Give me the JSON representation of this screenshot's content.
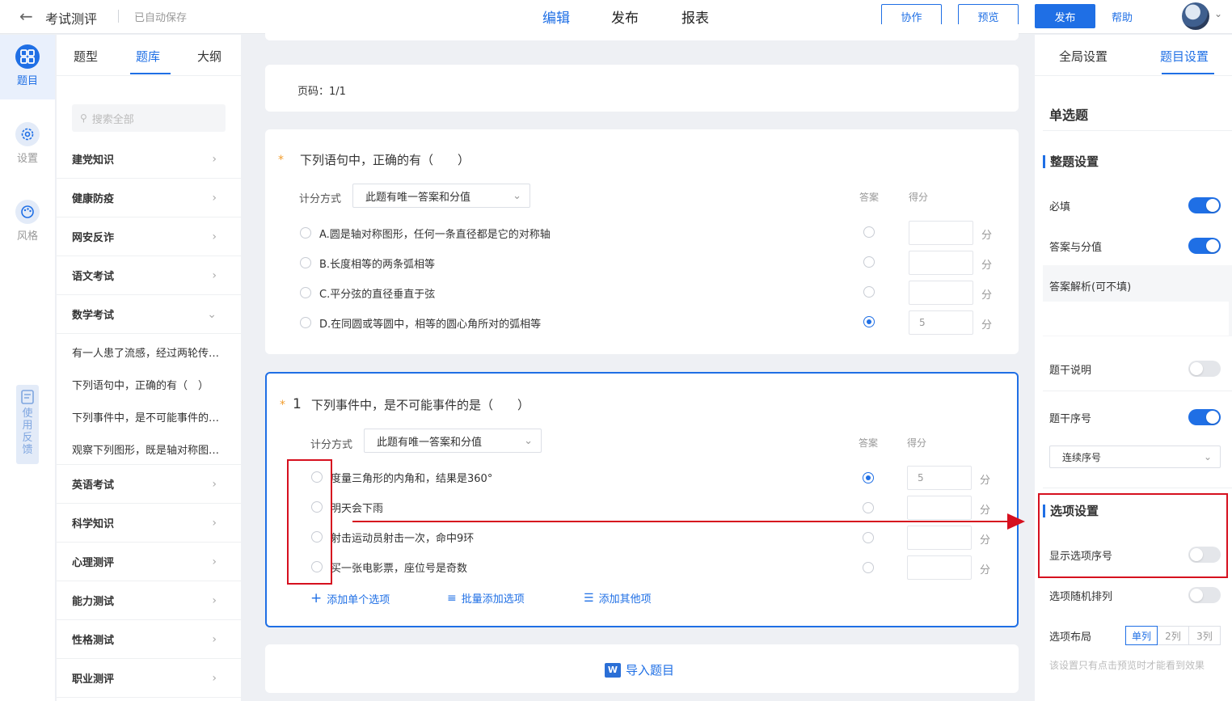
{
  "header": {
    "back_icon": "arrow-left-icon",
    "title": "考试测评",
    "autosave": "已自动保存",
    "tabs": [
      "编辑",
      "发布",
      "报表"
    ],
    "active_tab": "编辑",
    "buttons": {
      "collab": "协作",
      "preview": "预览",
      "publish": "发布",
      "help": "帮助"
    },
    "accent_color": "#1f6fe5"
  },
  "rail": {
    "items": [
      {
        "label": "题目",
        "icon": "grid-icon"
      },
      {
        "label": "设置",
        "icon": "gear-icon"
      },
      {
        "label": "风格",
        "icon": "palette-icon"
      }
    ],
    "feedback": "使用反馈"
  },
  "library": {
    "tabs": [
      "题型",
      "题库",
      "大纲"
    ],
    "active_tab": "题库",
    "search_placeholder": "搜索全部",
    "categories_top": [
      "建党知识",
      "健康防疫",
      "网安反诈",
      "语文考试",
      "数学考试"
    ],
    "expanded_questions": [
      "有一人患了流感，经过两轮传染后共有...",
      "下列语句中，正确的有（　）",
      "下列事件中，是不可能事件的是（　）",
      "观察下列图形，既是轴对称图形又是..."
    ],
    "categories_bottom": [
      "英语考试",
      "科学知识",
      "心理测评",
      "能力测试",
      "性格测试",
      "职业测评"
    ]
  },
  "main": {
    "page_label": "页码：1/1",
    "q_prev": {
      "title": "下列语句中，正确的有（　　）",
      "scoring_label": "计分方式",
      "scoring_value": "此题有唯一答案和分值",
      "col_answer": "答案",
      "col_score": "得分",
      "unit": "分",
      "options": [
        {
          "text": "A.圆是轴对称图形，任何一条直径都是它的对称轴",
          "correct": false,
          "score": ""
        },
        {
          "text": "B.长度相等的两条弧相等",
          "correct": false,
          "score": ""
        },
        {
          "text": "C.平分弦的直径垂直于弦",
          "correct": false,
          "score": ""
        },
        {
          "text": "D.在同圆或等圆中，相等的圆心角所对的弧相等",
          "correct": true,
          "score": "5"
        }
      ]
    },
    "q_active": {
      "number": "1",
      "title": "下列事件中，是不可能事件的是（　　）",
      "scoring_label": "计分方式",
      "scoring_value": "此题有唯一答案和分值",
      "col_answer": "答案",
      "col_score": "得分",
      "unit": "分",
      "options": [
        {
          "text": "度量三角形的内角和，结果是360°",
          "correct": true,
          "score": "5"
        },
        {
          "text": "明天会下雨",
          "correct": false,
          "score": ""
        },
        {
          "text": "射击运动员射击一次，命中9环",
          "correct": false,
          "score": ""
        },
        {
          "text": "买一张电影票，座位号是奇数",
          "correct": false,
          "score": ""
        }
      ],
      "add_single": "添加单个选项",
      "add_batch": "批量添加选项",
      "add_other": "添加其他项"
    },
    "import_label": "导入题目"
  },
  "right": {
    "tabs": [
      "全局设置",
      "题目设置"
    ],
    "active_tab": "题目设置",
    "qtype": "单选题",
    "whole_section": "整题设置",
    "required": {
      "label": "必填",
      "on": true
    },
    "answer_score": {
      "label": "答案与分值",
      "on": true
    },
    "analysis_label": "答案解析(可不填)",
    "stem_desc": {
      "label": "题干说明",
      "on": false
    },
    "stem_number": {
      "label": "题干序号",
      "on": true
    },
    "number_style": "连续序号",
    "options_section": "选项设置",
    "show_option_number": {
      "label": "显示选项序号",
      "on": false
    },
    "option_random": {
      "label": "选项随机排列",
      "on": false
    },
    "layout_label": "选项布局",
    "layout_options": [
      "单列",
      "2列",
      "3列"
    ],
    "layout_selected": "单列",
    "note": "该设置只有点击预览时才能看到效果"
  },
  "annotation": {
    "highlight_color": "#d6101f"
  }
}
